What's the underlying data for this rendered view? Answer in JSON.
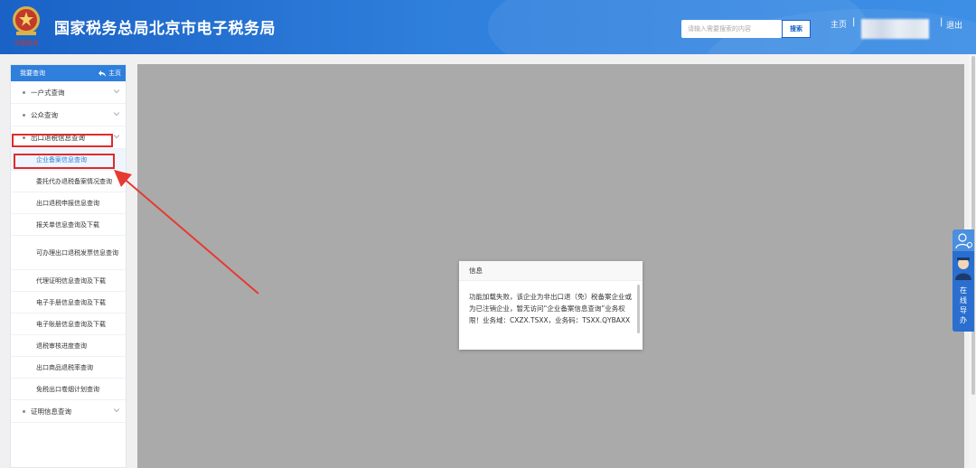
{
  "header": {
    "site_title": "国家税务总局北京市电子税务局",
    "search_placeholder": "请输入需要搜索的内容",
    "search_button": "搜索",
    "home_link": "主页",
    "separator": "|",
    "logout_link": "退出",
    "brand_color": "#2f7fdc"
  },
  "sidebar": {
    "header_title": "我要查询",
    "home_label": "主页",
    "sections": [
      {
        "label": "一户式查询",
        "icon": "chevron-down-icon"
      },
      {
        "label": "公众查询",
        "icon": "chevron-down-icon"
      },
      {
        "label": "出口退税信息查询",
        "icon": "chevron-down-icon"
      }
    ],
    "sub_items": [
      "企业备案信息查询",
      "委托代办退税备案情况查询",
      "出口退税申报信息查询",
      "报关单信息查询及下载",
      "可办理出口退税发票信息查询",
      "代理证明信息查询及下载",
      "电子手册信息查询及下载",
      "电子账册信息查询及下载",
      "退税审核进度查询",
      "出口商品退税率查询",
      "免税出口卷烟计划查询"
    ],
    "last_section": {
      "label": "证明信息查询",
      "icon": "chevron-down-icon"
    }
  },
  "dialog": {
    "title": "信息",
    "message": "功能加载失败，该企业为非出口退（免）税备案企业或为已注销企业，暂无访问“企业备案信息查询”业务权限！业务域：CXZX.TSXX，业务码：TSXX.QYBAXX"
  },
  "guide_widget": {
    "label": "在线导办"
  },
  "colors": {
    "highlight": "#e02a2a",
    "overlay": "#aaaaaa"
  }
}
